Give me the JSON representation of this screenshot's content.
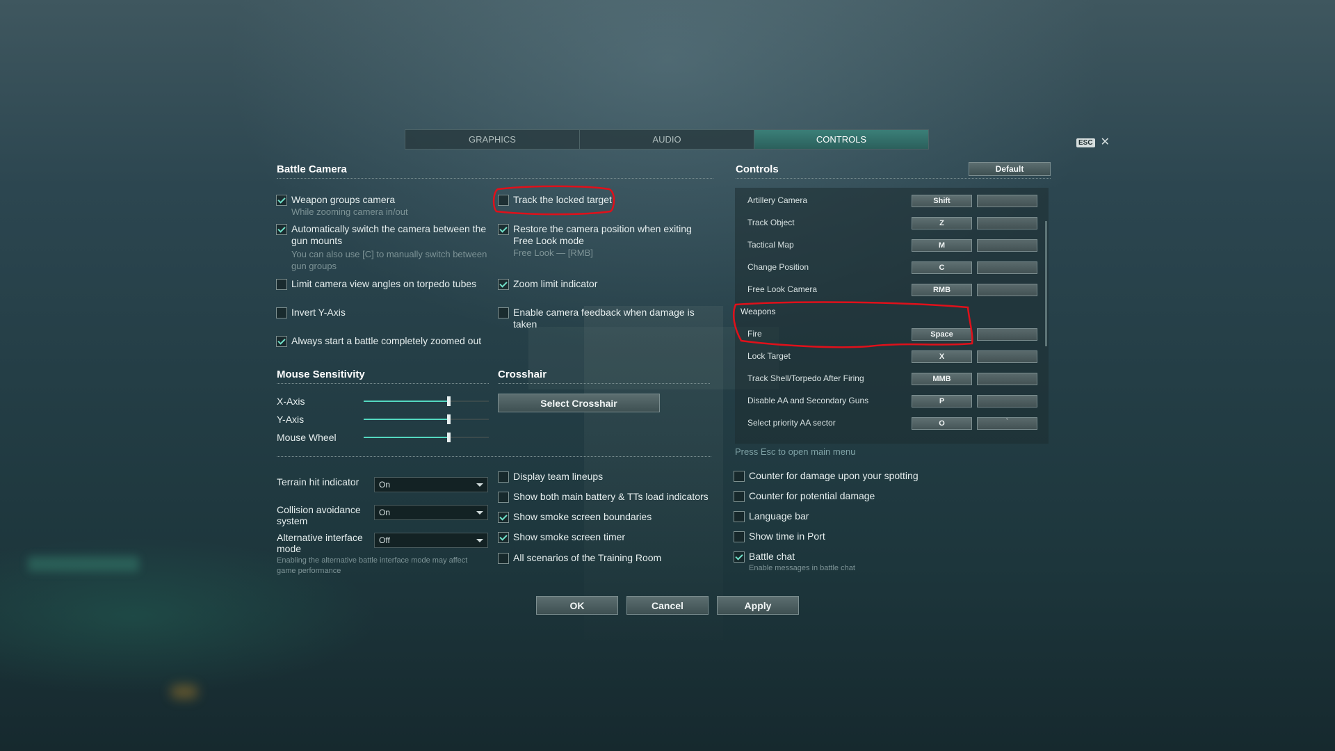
{
  "tabs": [
    {
      "label": "GRAPHICS",
      "active": false
    },
    {
      "label": "AUDIO",
      "active": false
    },
    {
      "label": "CONTROLS",
      "active": true
    }
  ],
  "esc_label": "ESC",
  "close_glyph": "✕",
  "battle_camera": {
    "title": "Battle Camera",
    "left": [
      {
        "label": "Weapon groups camera",
        "checked": true,
        "hint": "While zooming camera in/out"
      },
      {
        "label": "Automatically switch the camera between the gun mounts",
        "checked": true,
        "hint": "You can also use [C] to manually switch between gun groups"
      },
      {
        "label": "Limit camera view angles on torpedo tubes",
        "checked": false
      },
      {
        "label": "Invert Y-Axis",
        "checked": false
      },
      {
        "label": "Always start a battle completely zoomed out",
        "checked": true
      }
    ],
    "right": [
      {
        "label": "Track the locked target",
        "checked": false
      },
      {
        "label": "Restore the camera position when exiting Free Look mode",
        "checked": true,
        "hint": "Free Look — [RMB]"
      },
      {
        "label": "Zoom limit indicator",
        "checked": true
      },
      {
        "label": "Enable camera feedback when damage is taken",
        "checked": false
      }
    ]
  },
  "mouse_sensitivity": {
    "title": "Mouse Sensitivity",
    "sliders": [
      {
        "label": "X-Axis",
        "value": 0.68
      },
      {
        "label": "Y-Axis",
        "value": 0.68
      },
      {
        "label": "Mouse Wheel",
        "value": 0.68
      }
    ]
  },
  "crosshair": {
    "title": "Crosshair",
    "button": "Select Crosshair"
  },
  "dropdowns": [
    {
      "label": "Terrain hit indicator",
      "value": "On"
    },
    {
      "label": "Collision avoidance system",
      "value": "On"
    },
    {
      "label": "Alternative interface mode",
      "value": "Off",
      "hint": "Enabling the alternative battle interface mode may affect game performance"
    }
  ],
  "middle_options": [
    {
      "label": "Display team lineups",
      "checked": false
    },
    {
      "label": "Show both main battery & TTs load indicators",
      "checked": false
    },
    {
      "label": "Show smoke screen boundaries",
      "checked": true
    },
    {
      "label": "Show smoke screen timer",
      "checked": true
    },
    {
      "label": "All scenarios of the Training Room",
      "checked": false
    }
  ],
  "controls": {
    "title": "Controls",
    "default_button": "Default",
    "rows": [
      {
        "action": "Artillery Camera",
        "key": "Shift",
        "alt": ""
      },
      {
        "action": "Track Object",
        "key": "Z",
        "alt": ""
      },
      {
        "action": "Tactical Map",
        "key": "M",
        "alt": ""
      },
      {
        "action": "Change Position",
        "key": "C",
        "alt": ""
      },
      {
        "action": "Free Look Camera",
        "key": "RMB",
        "alt": ""
      }
    ],
    "group": "Weapons",
    "weapon_rows": [
      {
        "action": "Fire",
        "key": "Space",
        "alt": ""
      },
      {
        "action": "Lock Target",
        "key": "X",
        "alt": ""
      },
      {
        "action": "Track Shell/Torpedo After Firing",
        "key": "MMB",
        "alt": ""
      },
      {
        "action": "Disable AA and Secondary Guns",
        "key": "P",
        "alt": ""
      },
      {
        "action": "Select priority AA sector",
        "key": "O",
        "alt": "`"
      }
    ]
  },
  "press_esc_hint": "Press Esc to open main menu",
  "right_options": [
    {
      "label": "Counter for damage upon your spotting",
      "checked": false
    },
    {
      "label": "Counter for potential damage",
      "checked": false
    },
    {
      "label": "Language bar",
      "checked": false
    },
    {
      "label": "Show time in Port",
      "checked": false
    },
    {
      "label": "Battle chat",
      "checked": true,
      "hint": "Enable messages in battle chat"
    }
  ],
  "buttons": {
    "ok": "OK",
    "cancel": "Cancel",
    "apply": "Apply"
  },
  "colors": {
    "accent": "#54d8c0",
    "active_tab": "#3b7f78",
    "annotation": "#e0101a"
  }
}
